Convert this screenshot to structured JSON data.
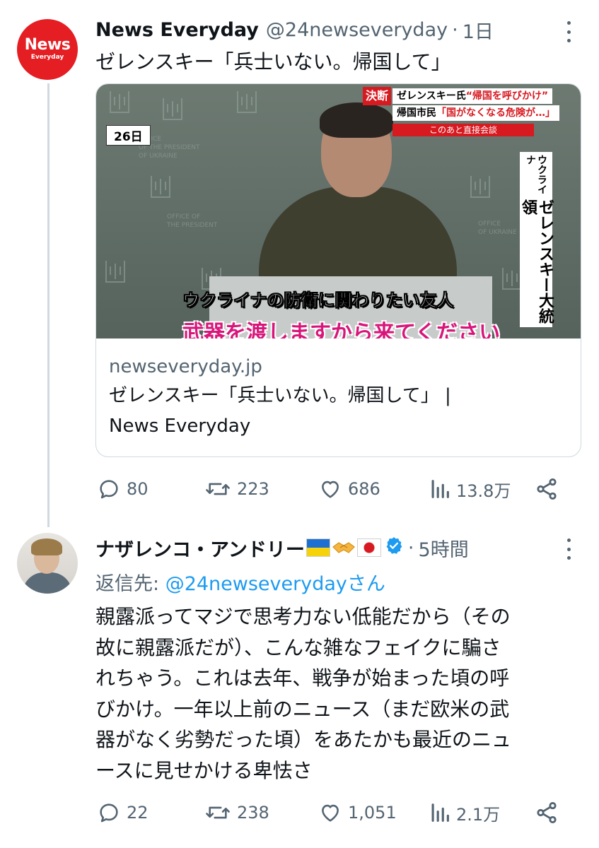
{
  "tweet1": {
    "avatar": {
      "line1": "News",
      "line2": "Everyday",
      "color": "#e41e23"
    },
    "display_name": "News Everyday",
    "handle": "@24newseveryday",
    "separator": "·",
    "time": "1日",
    "text": "ゼレンスキー「兵士いない。帰国して」",
    "card": {
      "image": {
        "date_tag": "26日",
        "banner_tag": "決断",
        "banner_line1_a": "ゼレンスキー氏",
        "banner_line1_b": "“帰国を呼びかけ”",
        "banner_line2_a": "帰国市民",
        "banner_line2_b": "「国がなくなる危険が…」",
        "banner_bottom": "このあと直接会談",
        "vertical_small": "ウクライナ",
        "vertical_big": "ゼレンスキー大統領",
        "subtitle_line1": "ウクライナの防衛に関わりたい友人",
        "subtitle_line2": "武器を渡しますから来てください"
      },
      "domain": "newseveryday.jp",
      "title_line1": "ゼレンスキー「兵士いない。帰国して」 |",
      "title_line2": "News Everyday"
    },
    "actions": {
      "replies": "80",
      "retweets": "223",
      "likes": "686",
      "views": "13.8万"
    }
  },
  "tweet2": {
    "display_name": "ナザレンコ・アンドリー",
    "emoji_names": [
      "ukraine-flag",
      "handshake",
      "japan-flag"
    ],
    "verified_color": "#1d9bf0",
    "separator": "·",
    "time": "5時間",
    "reply_prefix": "返信先: ",
    "reply_mention": "@24newseverydayさん",
    "body_lines": [
      "親露派ってマジで思考力ない低能だから（その",
      "故に親露派だが）、こんな雑なフェイクに騙さ",
      "れちゃう。これは去年、戦争が始まった頃の呼",
      "びかけ。一年以上前のニュース（まだ欧米の武",
      "器がなく劣勢だった頃）をあたかも最近のニュ",
      "ースに見せかける卑怯さ"
    ],
    "actions": {
      "replies": "22",
      "retweets": "238",
      "likes": "1,051",
      "views": "2.1万"
    }
  },
  "colors": {
    "text": "#0f1419",
    "muted": "#536471",
    "link": "#1d9bf0",
    "thread_line": "#cfd9de"
  }
}
